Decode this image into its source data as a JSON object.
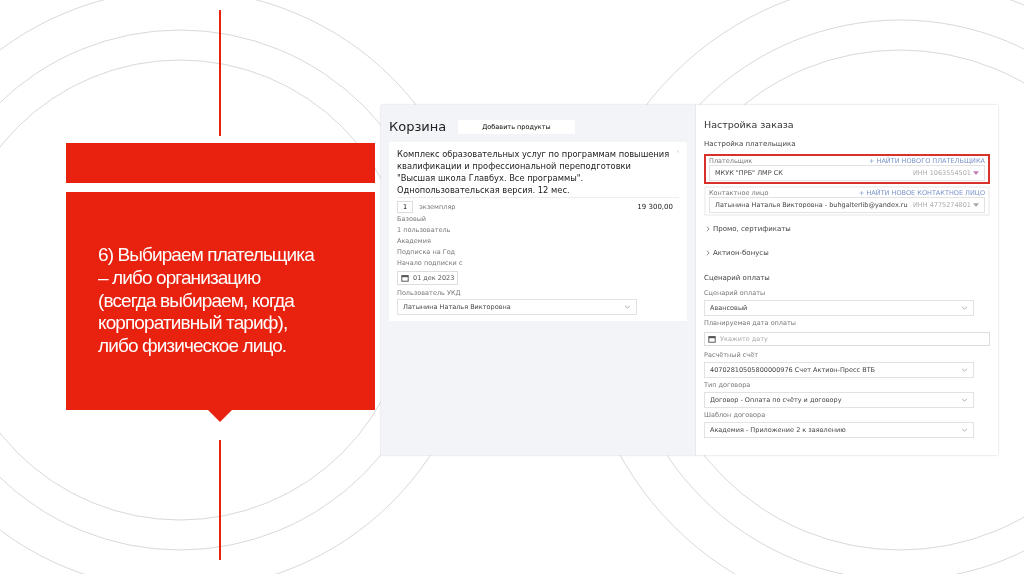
{
  "slide_text": "6) Выбираем плательщика – либо организацию (всегда выбираем, когда корпоративный тариф), либо физическое лицо.",
  "cart": {
    "title": "Корзина",
    "add_button": "Добавить продукты",
    "product": {
      "name": "Комплекс образовательных услуг по программам повышения квалификации и профессиональной переподготовки \"Высшая школа Главбух. Все программы\". Однопользовательская версия. 12 мес.",
      "quantity": "1",
      "unit": "экземпляр",
      "price": "19 300,00",
      "details": [
        "Базовый",
        "1 пользователь",
        "Академия",
        "Подписка на Год",
        "Начало подписки с"
      ],
      "start_date": "01 дек 2023",
      "user_label": "Пользователь УКД",
      "user_value": "Латынина Наталья Викторовна"
    }
  },
  "order": {
    "title": "Настройка заказа",
    "payer_section": "Настройка плательщика",
    "payer_fields": [
      {
        "label": "Плательщик",
        "link": "+ НАЙТИ НОВОГО ПЛАТЕЛЬЩИКА",
        "value": "МКУК \"ПРБ\" ЛМР СК",
        "extra": "ИНН 1063554501",
        "highlighted": true
      },
      {
        "label": "Контактное лицо",
        "link": "+ НАЙТИ НОВОЕ КОНТАКТНОЕ ЛИЦО",
        "value": "Латынина Наталья Викторовна - buhgalterlib@yandex.ru",
        "extra": "ИНН 4775274801",
        "highlighted": false
      }
    ],
    "collapsibles": [
      {
        "label": "Промо, сертификаты",
        "expanded": false
      },
      {
        "label": "Актион-бонусы",
        "expanded": false
      }
    ],
    "payment_section": "Сценарий оплаты",
    "payment_fields": [
      {
        "kind": "select",
        "label": "Сценарий оплаты",
        "value": "Авансовый"
      },
      {
        "kind": "date",
        "label": "Планируемая дата оплаты",
        "placeholder": "Укажите дату"
      },
      {
        "kind": "select",
        "label": "Расчётный счёт",
        "value": "40702810505800000976 Счет Актион-Пресс ВТБ"
      },
      {
        "kind": "select",
        "label": "Тип договора",
        "value": "Договор - Оплата по счёту и договору"
      },
      {
        "kind": "select",
        "label": "Шаблон договора",
        "value": "Академия - Приложение 2 к заявлению"
      }
    ]
  }
}
